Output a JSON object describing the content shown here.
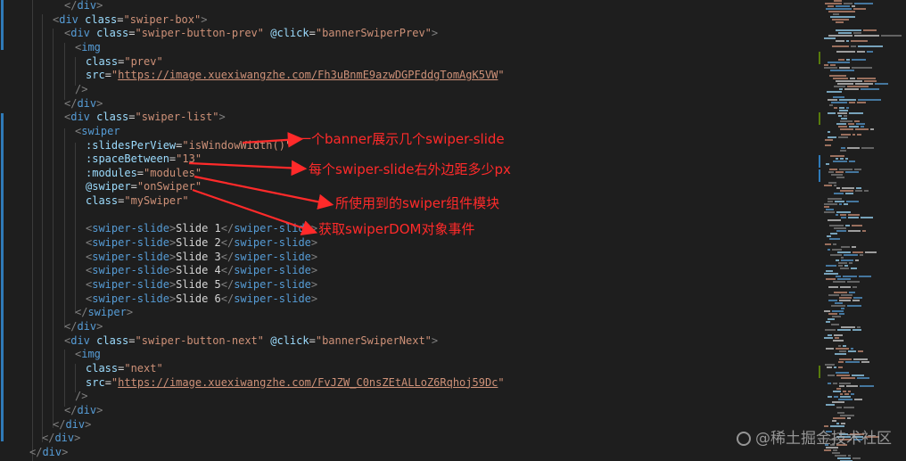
{
  "colors": {
    "background": "#1e1e1e",
    "punctuation": "#808080",
    "tag": "#569cd6",
    "attribute": "#9cdcfe",
    "string": "#ce9178",
    "text": "#d4d4d4",
    "annotation": "#ff2a2a",
    "modified_gutter": "#2f7ab8",
    "added_gutter": "#587c0c"
  },
  "code_lines": [
    [
      {
        "c": "punc",
        "t": "</"
      },
      {
        "c": "tag",
        "t": "div"
      },
      {
        "c": "punc",
        "t": ">"
      }
    ],
    [
      {
        "c": "punc",
        "t": "<"
      },
      {
        "c": "tag",
        "t": "div"
      },
      {
        "c": "text",
        "t": " "
      },
      {
        "c": "attr",
        "t": "class"
      },
      {
        "c": "text",
        "t": "="
      },
      {
        "c": "str",
        "t": "\"swiper-box\""
      },
      {
        "c": "punc",
        "t": ">"
      }
    ],
    [
      {
        "c": "punc",
        "t": "<"
      },
      {
        "c": "tag",
        "t": "div"
      },
      {
        "c": "text",
        "t": " "
      },
      {
        "c": "attr",
        "t": "class"
      },
      {
        "c": "text",
        "t": "="
      },
      {
        "c": "str",
        "t": "\"swiper-button-prev\""
      },
      {
        "c": "text",
        "t": " "
      },
      {
        "c": "attr",
        "t": "@click"
      },
      {
        "c": "text",
        "t": "="
      },
      {
        "c": "str",
        "t": "\"bannerSwiperPrev\""
      },
      {
        "c": "punc",
        "t": ">"
      }
    ],
    [
      {
        "c": "punc",
        "t": "<"
      },
      {
        "c": "tag",
        "t": "img"
      }
    ],
    [
      {
        "c": "attr",
        "t": "class"
      },
      {
        "c": "text",
        "t": "="
      },
      {
        "c": "str",
        "t": "\"prev\""
      }
    ],
    [
      {
        "c": "attr",
        "t": "src"
      },
      {
        "c": "text",
        "t": "="
      },
      {
        "c": "str",
        "t": "\""
      },
      {
        "c": "strul",
        "t": "https://image.xuexiwangzhe.com/Fh3uBnmE9azwDGPFddgTomAgK5VW"
      },
      {
        "c": "str",
        "t": "\""
      }
    ],
    [
      {
        "c": "punc",
        "t": "/>"
      }
    ],
    [
      {
        "c": "punc",
        "t": "</"
      },
      {
        "c": "tag",
        "t": "div"
      },
      {
        "c": "punc",
        "t": ">"
      }
    ],
    [
      {
        "c": "punc",
        "t": "<"
      },
      {
        "c": "tag",
        "t": "div"
      },
      {
        "c": "text",
        "t": " "
      },
      {
        "c": "attr",
        "t": "class"
      },
      {
        "c": "text",
        "t": "="
      },
      {
        "c": "str",
        "t": "\"swiper-list\""
      },
      {
        "c": "punc",
        "t": ">"
      }
    ],
    [
      {
        "c": "punc",
        "t": "<"
      },
      {
        "c": "tag",
        "t": "swiper"
      }
    ],
    [
      {
        "c": "attr",
        "t": ":slidesPerView"
      },
      {
        "c": "text",
        "t": "="
      },
      {
        "c": "str",
        "t": "\"isWindowWidth()\""
      }
    ],
    [
      {
        "c": "attr",
        "t": ":spaceBetween"
      },
      {
        "c": "text",
        "t": "="
      },
      {
        "c": "str",
        "t": "\"13\""
      }
    ],
    [
      {
        "c": "attr",
        "t": ":modules"
      },
      {
        "c": "text",
        "t": "="
      },
      {
        "c": "str",
        "t": "\"modules\""
      }
    ],
    [
      {
        "c": "attr",
        "t": "@swiper"
      },
      {
        "c": "text",
        "t": "="
      },
      {
        "c": "str",
        "t": "\"onSwiper\""
      }
    ],
    [
      {
        "c": "attr",
        "t": "class"
      },
      {
        "c": "text",
        "t": "="
      },
      {
        "c": "str",
        "t": "\"mySwiper\""
      }
    ],
    [],
    [
      {
        "c": "punc",
        "t": "<"
      },
      {
        "c": "tag",
        "t": "swiper-slide"
      },
      {
        "c": "punc",
        "t": ">"
      },
      {
        "c": "text",
        "t": "Slide 1"
      },
      {
        "c": "punc",
        "t": "</"
      },
      {
        "c": "tag",
        "t": "swiper-slide"
      },
      {
        "c": "punc",
        "t": ">"
      }
    ],
    [
      {
        "c": "punc",
        "t": "<"
      },
      {
        "c": "tag",
        "t": "swiper-slide"
      },
      {
        "c": "punc",
        "t": ">"
      },
      {
        "c": "text",
        "t": "Slide 2"
      },
      {
        "c": "punc",
        "t": "</"
      },
      {
        "c": "tag",
        "t": "swiper-slide"
      },
      {
        "c": "punc",
        "t": ">"
      }
    ],
    [
      {
        "c": "punc",
        "t": "<"
      },
      {
        "c": "tag",
        "t": "swiper-slide"
      },
      {
        "c": "punc",
        "t": ">"
      },
      {
        "c": "text",
        "t": "Slide 3"
      },
      {
        "c": "punc",
        "t": "</"
      },
      {
        "c": "tag",
        "t": "swiper-slide"
      },
      {
        "c": "punc",
        "t": ">"
      }
    ],
    [
      {
        "c": "punc",
        "t": "<"
      },
      {
        "c": "tag",
        "t": "swiper-slide"
      },
      {
        "c": "punc",
        "t": ">"
      },
      {
        "c": "text",
        "t": "Slide 4"
      },
      {
        "c": "punc",
        "t": "</"
      },
      {
        "c": "tag",
        "t": "swiper-slide"
      },
      {
        "c": "punc",
        "t": ">"
      }
    ],
    [
      {
        "c": "punc",
        "t": "<"
      },
      {
        "c": "tag",
        "t": "swiper-slide"
      },
      {
        "c": "punc",
        "t": ">"
      },
      {
        "c": "text",
        "t": "Slide 5"
      },
      {
        "c": "punc",
        "t": "</"
      },
      {
        "c": "tag",
        "t": "swiper-slide"
      },
      {
        "c": "punc",
        "t": ">"
      }
    ],
    [
      {
        "c": "punc",
        "t": "<"
      },
      {
        "c": "tag",
        "t": "swiper-slide"
      },
      {
        "c": "punc",
        "t": ">"
      },
      {
        "c": "text",
        "t": "Slide 6"
      },
      {
        "c": "punc",
        "t": "</"
      },
      {
        "c": "tag",
        "t": "swiper-slide"
      },
      {
        "c": "punc",
        "t": ">"
      }
    ],
    [
      {
        "c": "punc",
        "t": "</"
      },
      {
        "c": "tag",
        "t": "swiper"
      },
      {
        "c": "punc",
        "t": ">"
      }
    ],
    [
      {
        "c": "punc",
        "t": "</"
      },
      {
        "c": "tag",
        "t": "div"
      },
      {
        "c": "punc",
        "t": ">"
      }
    ],
    [
      {
        "c": "punc",
        "t": "<"
      },
      {
        "c": "tag",
        "t": "div"
      },
      {
        "c": "text",
        "t": " "
      },
      {
        "c": "attr",
        "t": "class"
      },
      {
        "c": "text",
        "t": "="
      },
      {
        "c": "str",
        "t": "\"swiper-button-next\""
      },
      {
        "c": "text",
        "t": " "
      },
      {
        "c": "attr",
        "t": "@click"
      },
      {
        "c": "text",
        "t": "="
      },
      {
        "c": "str",
        "t": "\"bannerSwiperNext\""
      },
      {
        "c": "punc",
        "t": ">"
      }
    ],
    [
      {
        "c": "punc",
        "t": "<"
      },
      {
        "c": "tag",
        "t": "img"
      }
    ],
    [
      {
        "c": "attr",
        "t": "class"
      },
      {
        "c": "text",
        "t": "="
      },
      {
        "c": "str",
        "t": "\"next\""
      }
    ],
    [
      {
        "c": "attr",
        "t": "src"
      },
      {
        "c": "text",
        "t": "="
      },
      {
        "c": "str",
        "t": "\""
      },
      {
        "c": "strul",
        "t": "https://image.xuexiwangzhe.com/FvJZW_C0nsZEtALLoZ6Rqhoj59Dc"
      },
      {
        "c": "str",
        "t": "\""
      }
    ],
    [
      {
        "c": "punc",
        "t": "/>"
      }
    ],
    [
      {
        "c": "punc",
        "t": "</"
      },
      {
        "c": "tag",
        "t": "div"
      },
      {
        "c": "punc",
        "t": ">"
      }
    ],
    [
      {
        "c": "punc",
        "t": "</"
      },
      {
        "c": "tag",
        "t": "div"
      },
      {
        "c": "punc",
        "t": ">"
      }
    ],
    [
      {
        "c": "punc",
        "t": "</"
      },
      {
        "c": "tag",
        "t": "div"
      },
      {
        "c": "punc",
        "t": ">"
      }
    ],
    [
      {
        "c": "punc",
        "t": "</"
      },
      {
        "c": "tag",
        "t": "div"
      },
      {
        "c": "punc",
        "t": ">"
      }
    ]
  ],
  "annotations": [
    "一个banner展示几个swiper-slide",
    "每个swiper-slide右外边距多少px",
    "所使用到的swiper组件模块",
    "获取swiperDOM对象事件"
  ],
  "watermark": "@稀土掘金技术社区"
}
